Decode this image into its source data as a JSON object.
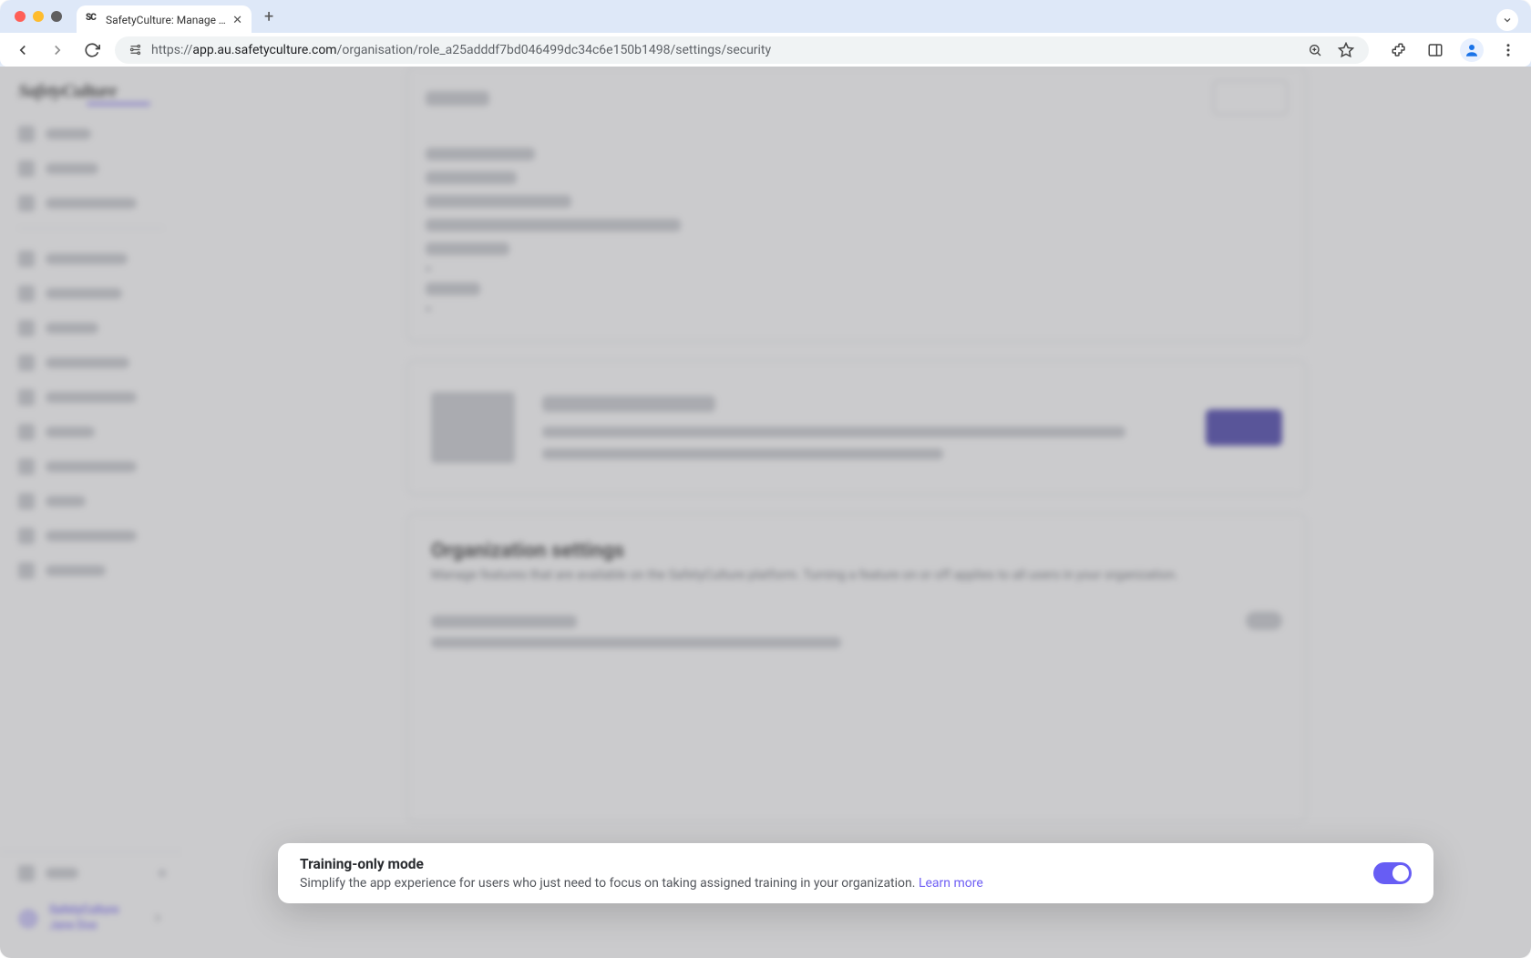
{
  "browser": {
    "tab_title": "SafetyCulture: Manage Teams and...",
    "url_display_prefix": "https://",
    "url_display_host": "app.au.safetyculture.com",
    "url_display_path": "/organisation/role_a25adddf7bd046499dc34c6e150b1498/settings/security"
  },
  "sidebar": {
    "logo_text": "SafetyCulture",
    "bottom_org_name": "SafetyCulture",
    "bottom_user_name": "Jane Doe"
  },
  "main": {
    "org_settings": {
      "title": "Organization settings",
      "subtitle": "Manage features that are available on the SafetyCulture platform. Turning a feature on or off applies to all users in your organization."
    }
  },
  "highlight": {
    "title": "Training-only mode",
    "description": "Simplify the app experience for users who just need to focus on taking assigned training in your organization. ",
    "learn_more_label": "Learn more",
    "toggle_on": true
  }
}
